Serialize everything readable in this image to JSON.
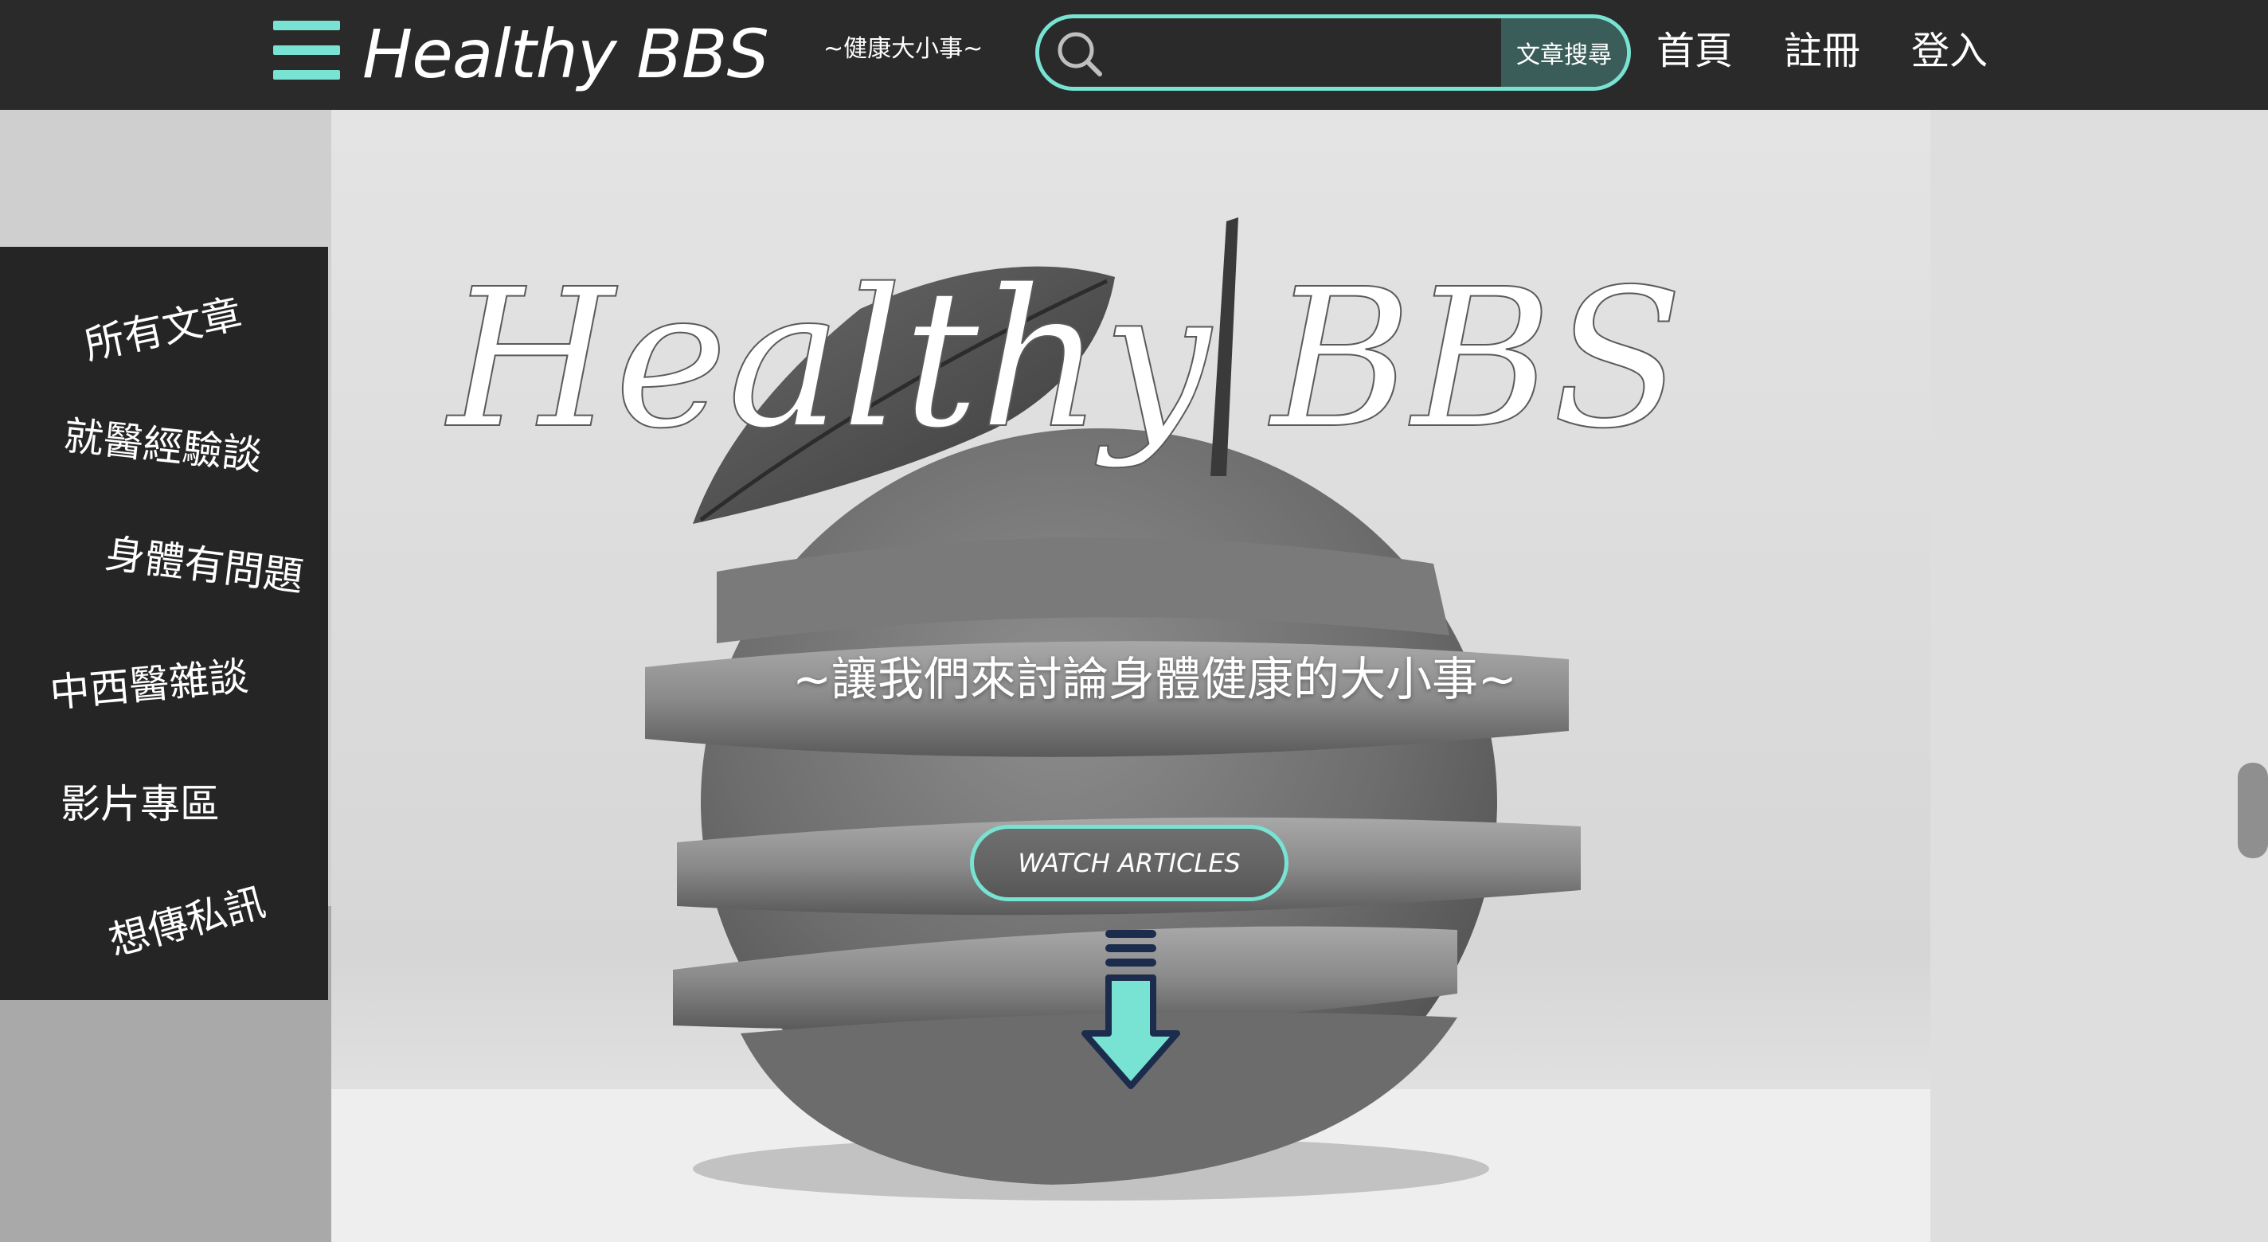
{
  "header": {
    "brand": "Healthy BBS",
    "subtitle": "~健康大小事~",
    "search": {
      "placeholder": "",
      "button_label": "文章搜尋"
    },
    "nav": [
      {
        "label": "首頁"
      },
      {
        "label": "註冊"
      },
      {
        "label": "登入"
      }
    ]
  },
  "sidebar": {
    "items": [
      {
        "label": "所有文章"
      },
      {
        "label": "就醫經驗談"
      },
      {
        "label": "身體有問題"
      },
      {
        "label": "中西醫雜談"
      },
      {
        "label": "影片專區"
      },
      {
        "label": "想傳私訊"
      }
    ]
  },
  "hero": {
    "script_title": "Healthy BBS",
    "tagline": "~讓我們來討論身體健康的大小事~",
    "cta_label": "WATCH ARTICLES"
  },
  "colors": {
    "accent": "#78e3d2",
    "header_bg": "#2a2a2a",
    "sidebar_bg": "#252525",
    "arrow_navy": "#1c2c4c"
  },
  "icons": [
    "menu-icon",
    "search-icon",
    "down-arrow-icon"
  ]
}
